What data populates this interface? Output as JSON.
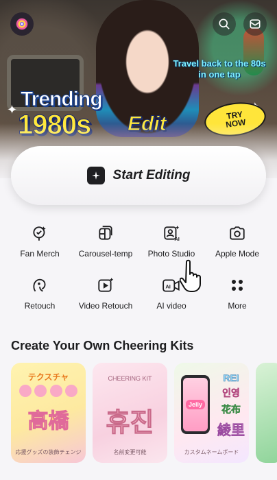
{
  "hero": {
    "tagline": "Travel back to the 80s in one tap",
    "trend_word": "Trending",
    "year_word": "1980s",
    "edit_word": "Edit",
    "try_badge": "TRY\nNOW",
    "colors": {
      "accent_yellow": "#ffe73a",
      "accent_cyan": "#7ff0ff"
    }
  },
  "top_bar": {
    "icons": [
      "app-logo-icon",
      "search-icon",
      "inbox-icon"
    ]
  },
  "start_card": {
    "label": "Start Editing",
    "icon": "sparkle-icon"
  },
  "tools": [
    {
      "label": "Fan Merch",
      "icon": "fan-merch-icon"
    },
    {
      "label": "Carousel-temp",
      "icon": "carousel-icon"
    },
    {
      "label": "Photo Studio",
      "icon": "ai-portrait-icon"
    },
    {
      "label": "Apple Mode",
      "icon": "camera-icon"
    },
    {
      "label": "Retouch",
      "icon": "retouch-face-icon"
    },
    {
      "label": "Video Retouch",
      "icon": "video-retouch-icon"
    },
    {
      "label": "AI video",
      "icon": "ai-video-icon"
    },
    {
      "label": "More",
      "icon": "grid-dots-icon"
    }
  ],
  "cheering_kits": {
    "title": "Create Your Own Cheering Kits",
    "items": [
      {
        "top": "テクスチャ",
        "main": "高橋",
        "bottom": "応援グッズの装飾チェンジ"
      },
      {
        "top": "CHEERING KIT",
        "main": "휴진",
        "bottom": "名前変更可能"
      },
      {
        "phone_label": "Jelly",
        "side": [
          "REI",
          "인영",
          "花布",
          "綾里"
        ],
        "bottom": "カスタムネームボード"
      },
      {}
    ]
  }
}
